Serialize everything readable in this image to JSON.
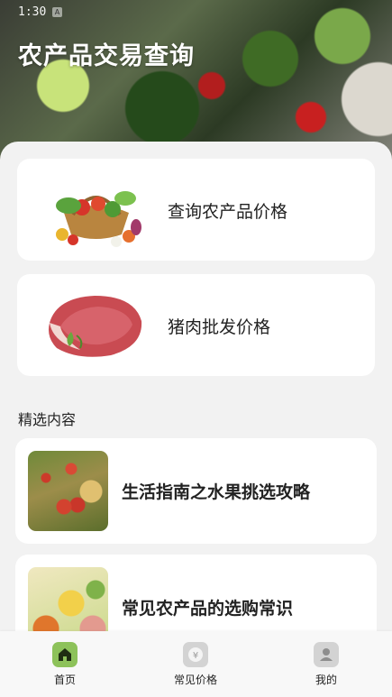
{
  "status": {
    "time": "1:30",
    "indicator": "A"
  },
  "header": {
    "title": "农产品交易查询"
  },
  "cards": [
    {
      "label": "查询农产品价格",
      "icon": "vegetable-basket"
    },
    {
      "label": "猪肉批发价格",
      "icon": "pork-meat"
    }
  ],
  "featured": {
    "title": "精选内容",
    "articles": [
      {
        "title": "生活指南之水果挑选攻略",
        "image": "apple-tree"
      },
      {
        "title": "常见农产品的选购常识",
        "image": "mixed-produce"
      }
    ]
  },
  "tabs": [
    {
      "label": "首页",
      "icon": "home-icon",
      "active": true
    },
    {
      "label": "常见价格",
      "icon": "yuan-icon",
      "active": false
    },
    {
      "label": "我的",
      "icon": "user-icon",
      "active": false
    }
  ],
  "colors": {
    "active_tab": "#8dc25a",
    "inactive_tab": "#d3d3d3"
  }
}
